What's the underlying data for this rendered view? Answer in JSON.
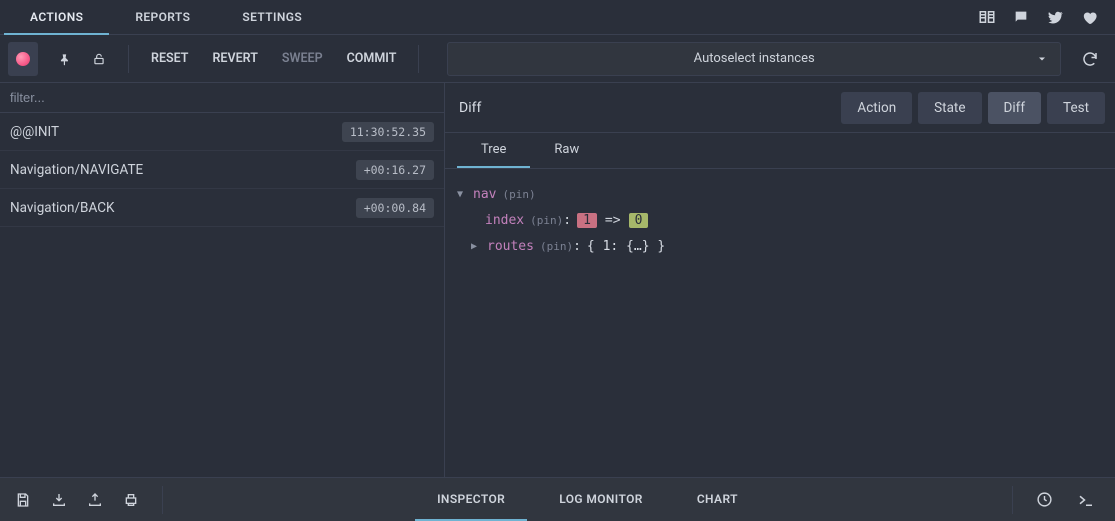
{
  "top_tabs": {
    "actions": "ACTIONS",
    "reports": "REPORTS",
    "settings": "SETTINGS"
  },
  "toolbar": {
    "reset": "RESET",
    "revert": "REVERT",
    "sweep": "SWEEP",
    "commit": "COMMIT"
  },
  "instance_selector": "Autoselect instances",
  "filter_placeholder": "filter...",
  "actions": [
    {
      "name": "@@INIT",
      "time": "11:30:52.35"
    },
    {
      "name": "Navigation/NAVIGATE",
      "time": "+00:16.27"
    },
    {
      "name": "Navigation/BACK",
      "time": "+00:00.84"
    }
  ],
  "right": {
    "title": "Diff",
    "seg": {
      "action": "Action",
      "state": "State",
      "diff": "Diff",
      "test": "Test"
    },
    "subtabs": {
      "tree": "Tree",
      "raw": "Raw"
    }
  },
  "diff_tree": {
    "root_key": "nav",
    "pin_label": "(pin)",
    "index_key": "index",
    "index_old": "1",
    "arrow_op": "=>",
    "index_new": "0",
    "routes_key": "routes",
    "routes_preview": "{ 1: {…} }"
  },
  "bottom_tabs": {
    "inspector": "INSPECTOR",
    "log_monitor": "LOG MONITOR",
    "chart": "CHART"
  }
}
